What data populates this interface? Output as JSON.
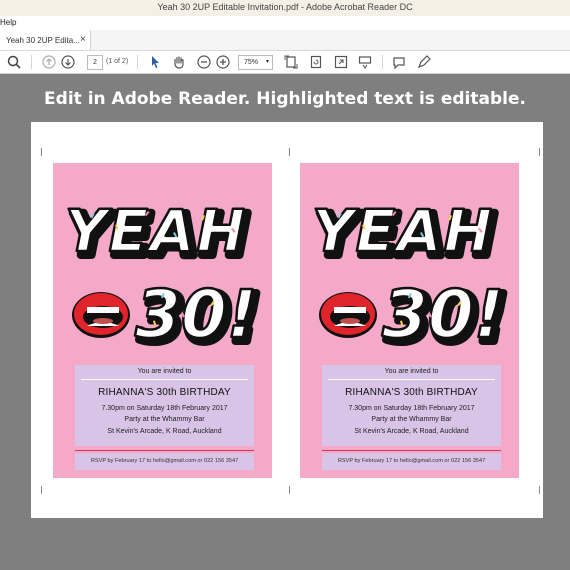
{
  "window": {
    "title": "Yeah 30 2UP Editable Invitation.pdf - Adobe Acrobat Reader DC"
  },
  "menu": {
    "help": "Help"
  },
  "tab": {
    "label": "Yeah 30 2UP Edita...",
    "close": "×"
  },
  "toolbar": {
    "page_number": "2",
    "page_count": "(1 of 2)",
    "zoom": "75%"
  },
  "banner": "Edit in Adobe Reader. Highlighted text is editable.",
  "invitation": {
    "art_text": "YEAH 30!",
    "invited": "You are invited to",
    "name": "RIHANNA'S 30th BIRTHDAY",
    "when": "7.30pm on Saturday 18th February 2017",
    "venue": "Party at the Whammy Bar",
    "address": "St Kevin's Arcade, K Road, Auckland",
    "rsvp": "RSVP by February 17 to hello@gmail.com or 022 156 3547"
  },
  "colors": {
    "card": "#f4a9c8",
    "info_panel": "#d8c4e6",
    "lips": "#e0242b",
    "viewer": "#7f7f7f"
  }
}
